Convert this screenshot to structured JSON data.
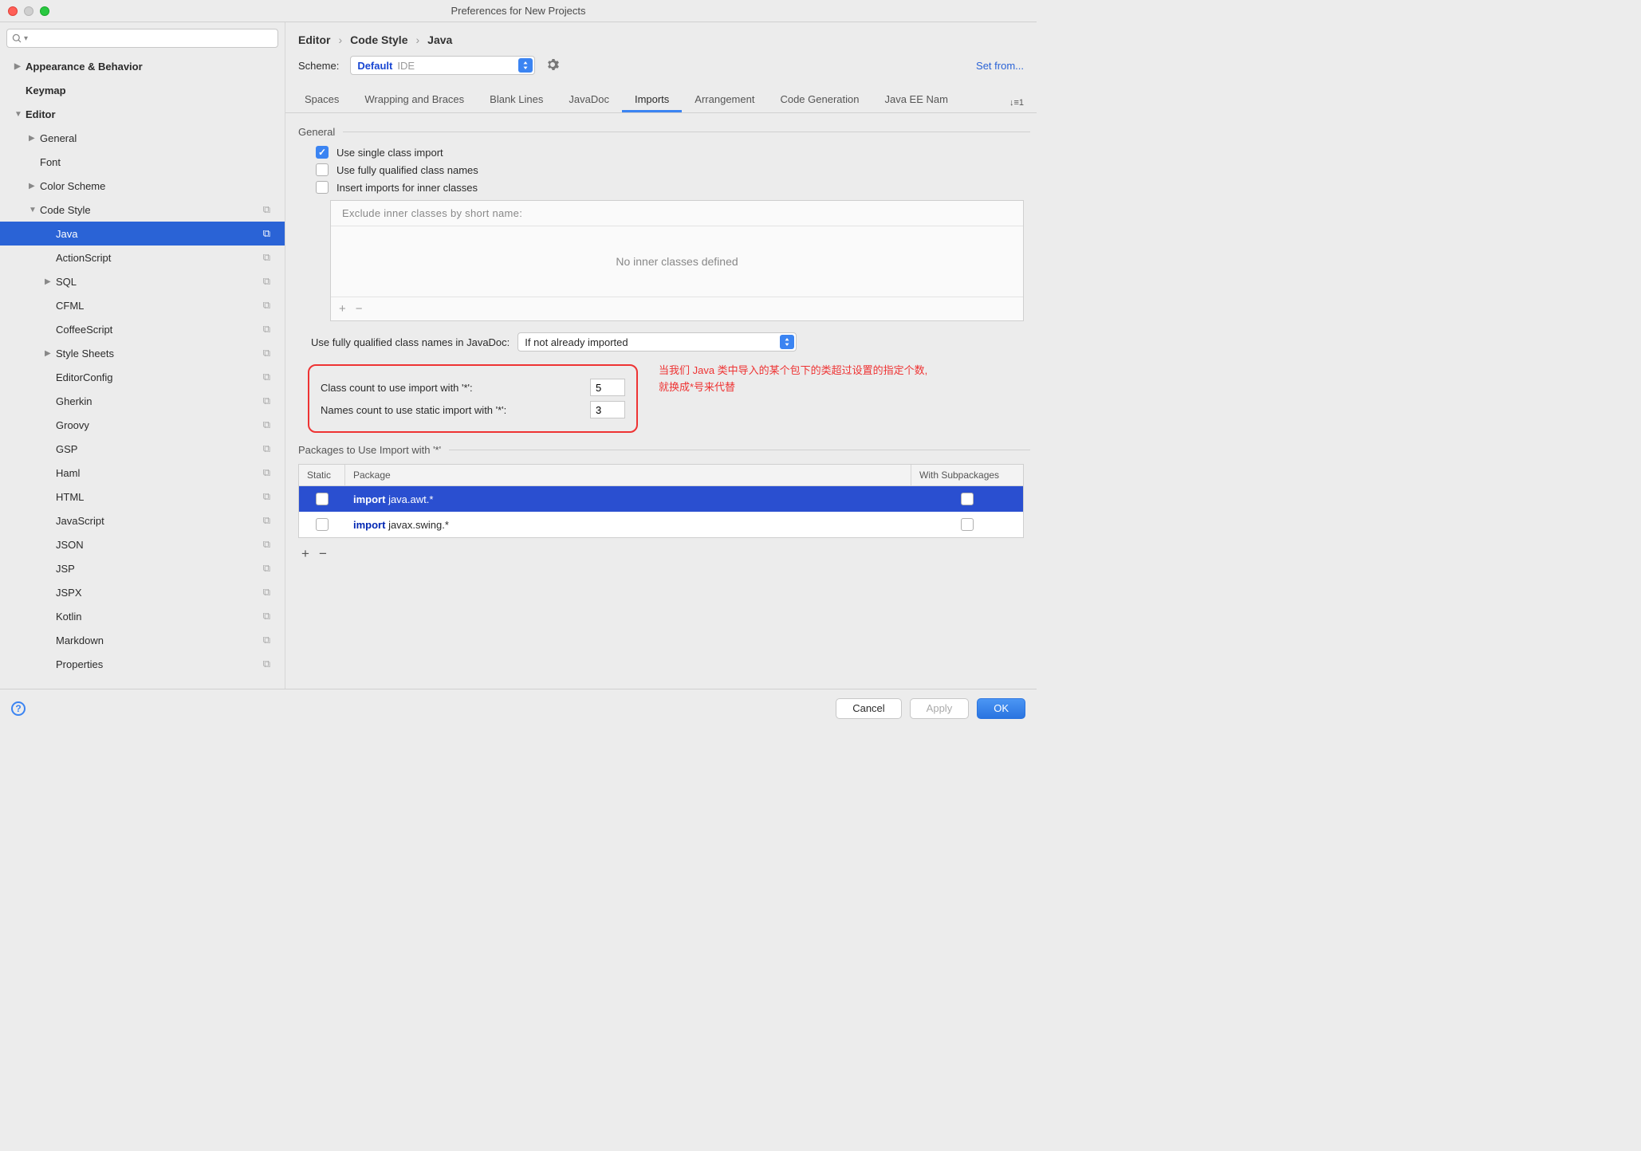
{
  "window": {
    "title": "Preferences for New Projects"
  },
  "sidebar": {
    "items": [
      {
        "label": "Appearance & Behavior",
        "depth": 0,
        "bold": true,
        "arrow": "▶"
      },
      {
        "label": "Keymap",
        "depth": 0,
        "bold": true
      },
      {
        "label": "Editor",
        "depth": 0,
        "bold": true,
        "arrow": "▼"
      },
      {
        "label": "General",
        "depth": 1,
        "arrow": "▶"
      },
      {
        "label": "Font",
        "depth": 1
      },
      {
        "label": "Color Scheme",
        "depth": 1,
        "arrow": "▶"
      },
      {
        "label": "Code Style",
        "depth": 1,
        "arrow": "▼",
        "copy": true
      },
      {
        "label": "Java",
        "depth": 2,
        "copy": true,
        "selected": true
      },
      {
        "label": "ActionScript",
        "depth": 2,
        "copy": true
      },
      {
        "label": "SQL",
        "depth": 2,
        "arrow": "▶",
        "copy": true
      },
      {
        "label": "CFML",
        "depth": 2,
        "copy": true
      },
      {
        "label": "CoffeeScript",
        "depth": 2,
        "copy": true
      },
      {
        "label": "Style Sheets",
        "depth": 2,
        "arrow": "▶",
        "copy": true
      },
      {
        "label": "EditorConfig",
        "depth": 2,
        "copy": true
      },
      {
        "label": "Gherkin",
        "depth": 2,
        "copy": true
      },
      {
        "label": "Groovy",
        "depth": 2,
        "copy": true
      },
      {
        "label": "GSP",
        "depth": 2,
        "copy": true
      },
      {
        "label": "Haml",
        "depth": 2,
        "copy": true
      },
      {
        "label": "HTML",
        "depth": 2,
        "copy": true
      },
      {
        "label": "JavaScript",
        "depth": 2,
        "copy": true
      },
      {
        "label": "JSON",
        "depth": 2,
        "copy": true
      },
      {
        "label": "JSP",
        "depth": 2,
        "copy": true
      },
      {
        "label": "JSPX",
        "depth": 2,
        "copy": true
      },
      {
        "label": "Kotlin",
        "depth": 2,
        "copy": true
      },
      {
        "label": "Markdown",
        "depth": 2,
        "copy": true
      },
      {
        "label": "Properties",
        "depth": 2,
        "copy": true
      }
    ]
  },
  "breadcrumb": {
    "a": "Editor",
    "b": "Code Style",
    "c": "Java"
  },
  "scheme": {
    "label": "Scheme:",
    "value": "Default",
    "scope": "IDE",
    "setfrom": "Set from..."
  },
  "tabs": [
    "Spaces",
    "Wrapping and Braces",
    "Blank Lines",
    "JavaDoc",
    "Imports",
    "Arrangement",
    "Code Generation",
    "Java EE Nam"
  ],
  "tabs_extra": "↓≡1",
  "active_tab": "Imports",
  "general": {
    "title": "General",
    "opt1": "Use single class import",
    "opt2": "Use fully qualified class names",
    "opt3": "Insert imports for inner classes",
    "exclude_hdr": "Exclude inner classes by short name:",
    "exclude_empty": "No inner classes defined"
  },
  "fq": {
    "label": "Use fully qualified class names in JavaDoc:",
    "value": "If not already imported"
  },
  "counts": {
    "class_label": "Class count to use import with '*':",
    "class_value": "5",
    "names_label": "Names count to use static import with '*':",
    "names_value": "3"
  },
  "annotation": {
    "line1": "当我们 Java 类中导入的某个包下的类超过设置的指定个数,",
    "line2": "就换成*号来代替"
  },
  "pkg": {
    "title": "Packages to Use Import with '*'",
    "col_static": "Static",
    "col_pkg": "Package",
    "col_sub": "With Subpackages",
    "rows": [
      {
        "kw": "import",
        "pkg": " java.awt.*",
        "selected": true
      },
      {
        "kw": "import",
        "pkg": " javax.swing.*"
      }
    ]
  },
  "footer": {
    "cancel": "Cancel",
    "apply": "Apply",
    "ok": "OK"
  }
}
